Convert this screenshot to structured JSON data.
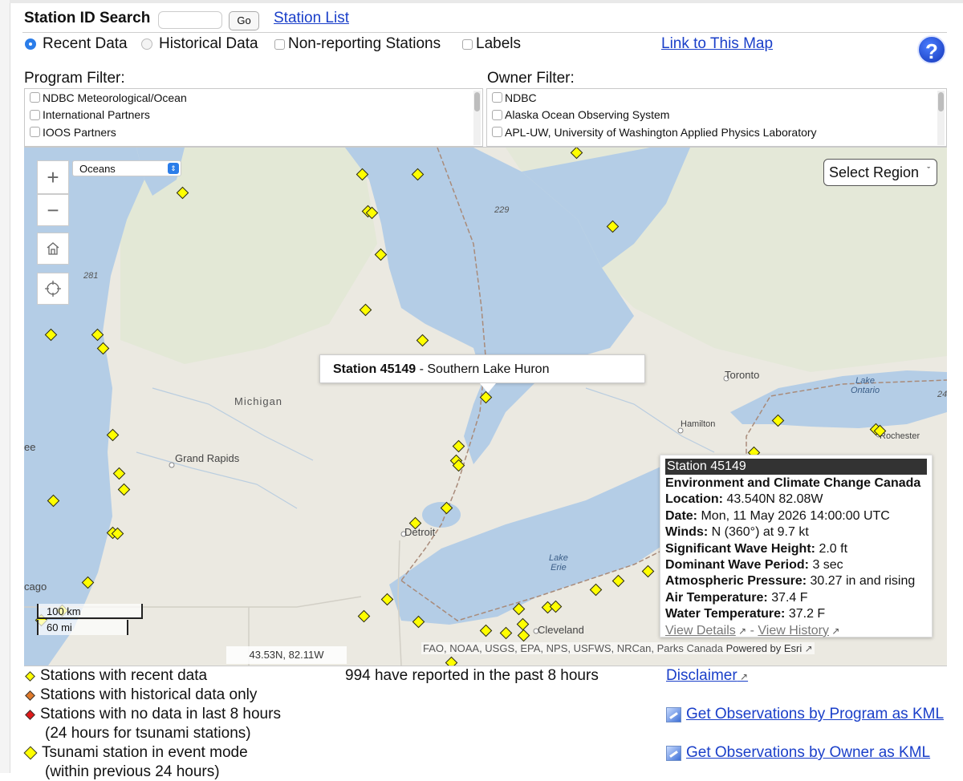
{
  "header": {
    "search_label": "Station ID Search",
    "search_value": "",
    "go_label": "Go",
    "station_list_label": "Station List"
  },
  "options": {
    "recent": "Recent Data",
    "historical": "Historical Data",
    "nonreporting": "Non-reporting Stations",
    "labels": "Labels",
    "link_map": "Link to This Map",
    "help": "?"
  },
  "filters": {
    "program_label": "Program Filter:",
    "program_items": [
      "NDBC Meteorological/Ocean",
      "International Partners",
      "IOOS Partners"
    ],
    "owner_label": "Owner Filter:",
    "owner_items": [
      "NDBC",
      "Alaska Ocean Observing System",
      "APL-UW, University of Washington Applied Physics Laboratory"
    ]
  },
  "map": {
    "basemap": "Oceans",
    "select_region": "Select Region",
    "labels": {
      "michigan": "Michigan",
      "grand_rapids": "Grand Rapids",
      "detroit": "Detroit",
      "toronto": "Toronto",
      "hamilton": "Hamilton",
      "rochester": "Rochester",
      "cleveland": "Cleveland",
      "lake_ontario": "Lake\nOntario",
      "lake_erie": "Lake\nErie",
      "road_229": "229",
      "road_281": "281",
      "road_24": "24",
      "edge_ee": "ee",
      "edge_cago": "cago"
    },
    "tooltip": {
      "id": "Station 45149",
      "separator": " - ",
      "name": "Southern Lake Huron"
    },
    "popup": {
      "header": "Station 45149",
      "owner": "Environment and Climate Change Canada",
      "location_label": "Location:",
      "location": "43.540N 82.08W",
      "date_label": "Date:",
      "date": "Mon, 11 May 2026 14:00:00 UTC",
      "winds_label": "Winds:",
      "winds": "N (360°) at 9.7 kt",
      "wave_height_label": "Significant Wave Height:",
      "wave_height": "2.0 ft",
      "wave_period_label": "Dominant Wave Period:",
      "wave_period": "3 sec",
      "pressure_label": "Atmospheric Pressure:",
      "pressure": "30.27 in and rising",
      "air_temp_label": "Air Temperature:",
      "air_temp": "37.4 F",
      "water_temp_label": "Water Temperature:",
      "water_temp": "37.2 F",
      "view_details": "View Details",
      "link_separator": "-",
      "view_history": "View History"
    },
    "scale_km": "100 km",
    "scale_mi": "60 mi",
    "coords": "43.53N, 82.11W",
    "attribution": "FAO, NOAA, USGS, EPA, NPS, USFWS, NRCan, Parks Canada",
    "powered_by": "Powered by Esri"
  },
  "legend": {
    "recent": "Stations with recent data",
    "historical": "Stations with historical data only",
    "nodata": "Stations with no data in last 8 hours",
    "nodata_sub": "(24 hours for tsunami stations)",
    "tsunami": "Tsunami station in event mode",
    "tsunami_sub": "(within previous 24 hours)",
    "colors": {
      "recent": "#ffff00",
      "historical": "#e07a2a",
      "nodata": "#e01919",
      "tsunami": "#ffff00"
    }
  },
  "footer": {
    "reported": "994 have reported in the past 8 hours",
    "disclaimer": "Disclaimer",
    "kml_program": "Get Observations by Program as KML",
    "kml_owner": "Get Observations by Owner as KML"
  }
}
